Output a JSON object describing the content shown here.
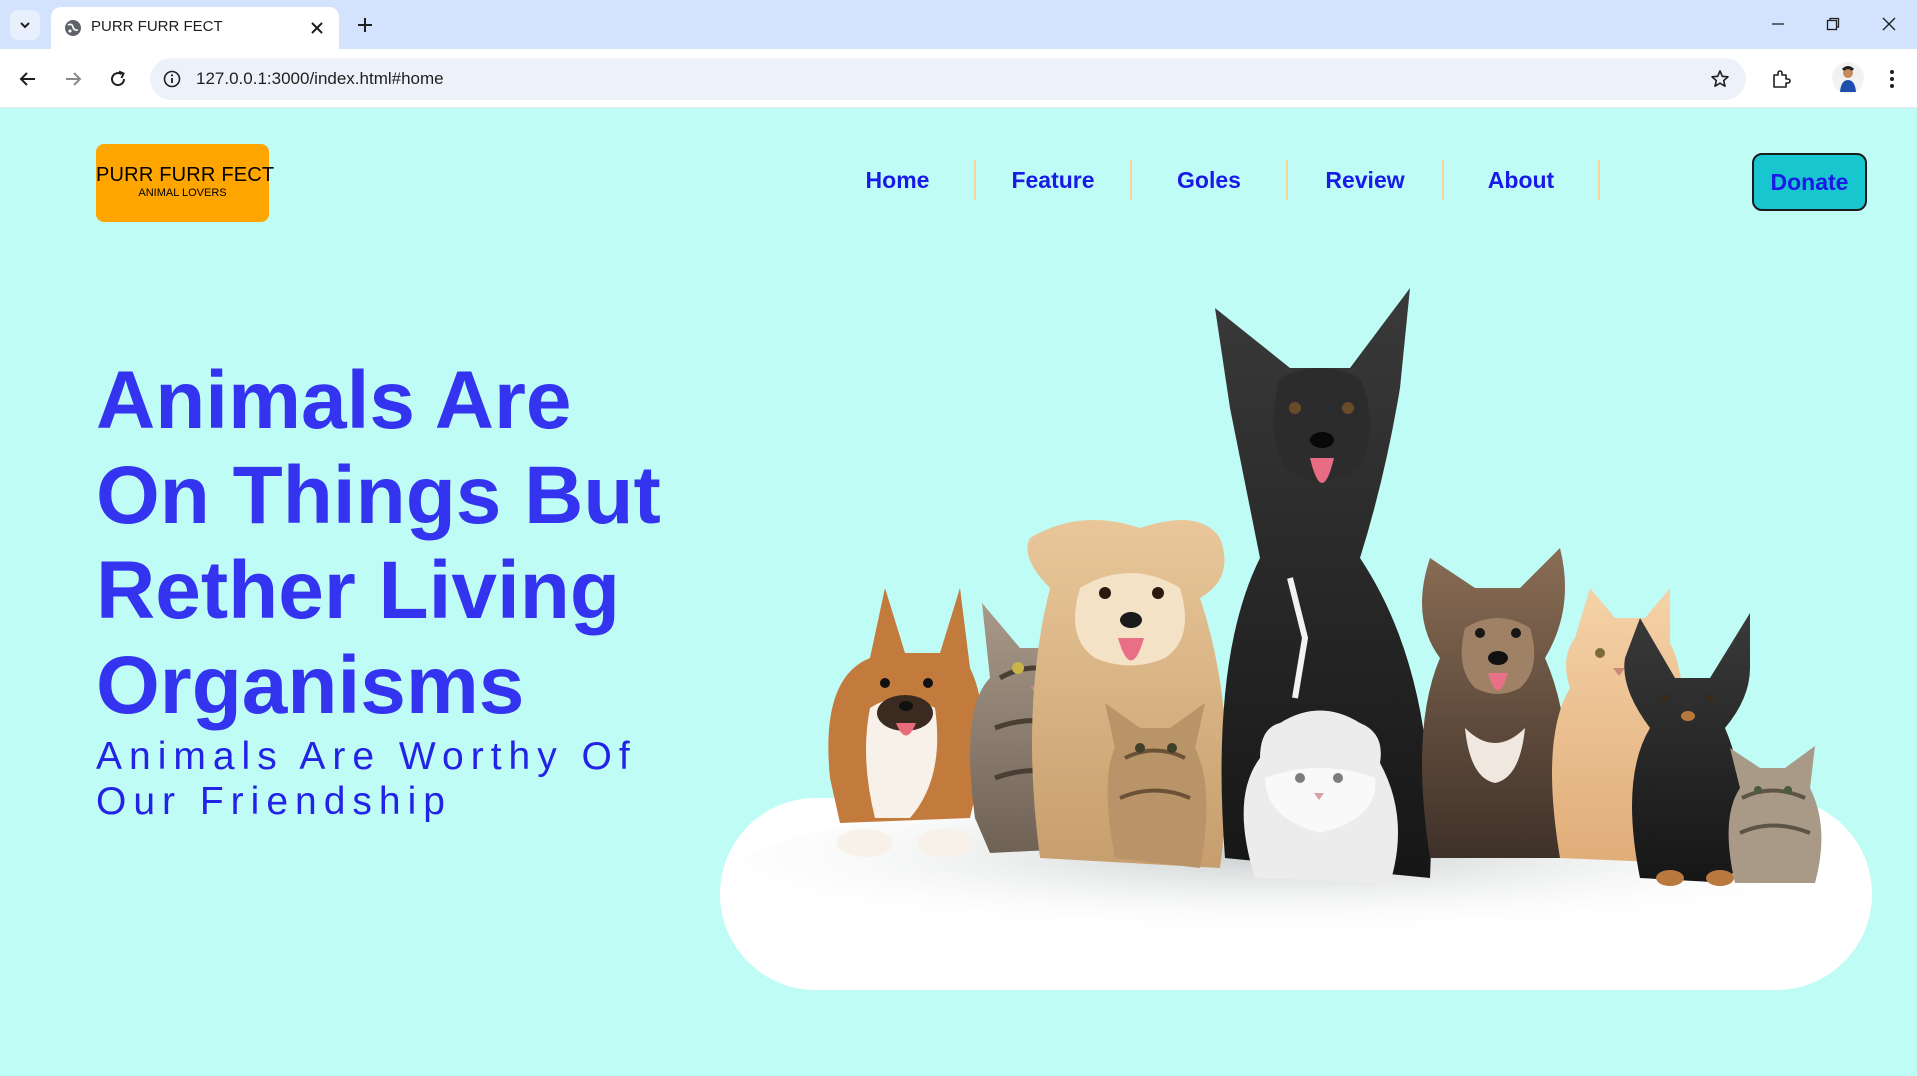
{
  "browser": {
    "tab_title": "PURR FURR FECT",
    "url": "127.0.0.1:3000/index.html#home"
  },
  "logo": {
    "title": "PURR FURR FECT",
    "subtitle": "ANIMAL LOVERS"
  },
  "nav": {
    "items": [
      "Home",
      "Feature",
      "Goles",
      "Review",
      "About"
    ]
  },
  "donate_label": "Donate",
  "hero": {
    "headline_lines": [
      "Animals Are",
      "On Things But",
      "Rether Living",
      "Organisms"
    ],
    "tagline_lines": [
      "Animals Are Worthy Of",
      "Our Friendship"
    ],
    "image_alt": "group of dogs and cats"
  },
  "colors": {
    "page_background": "#bffcf6",
    "logo_background": "#ffa500",
    "accent_text": "#3434f0",
    "donate_background": "#18c6cf"
  }
}
